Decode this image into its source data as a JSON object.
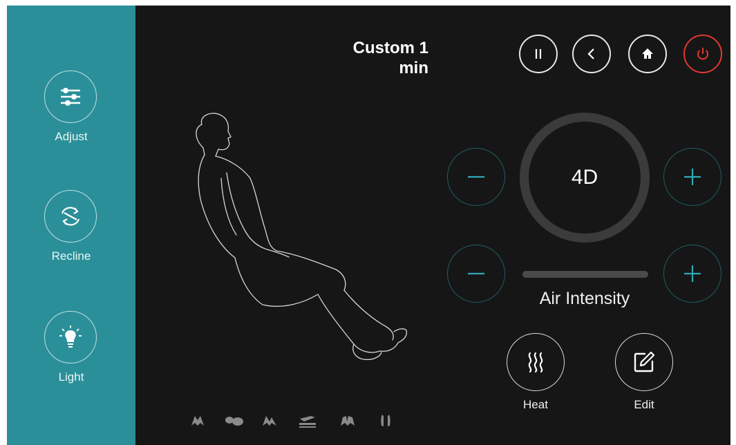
{
  "sidebar": {
    "items": [
      {
        "label": "Adjust",
        "icon": "sliders-icon"
      },
      {
        "label": "Recline",
        "icon": "recline-icon"
      },
      {
        "label": "Light",
        "icon": "lightbulb-icon"
      }
    ]
  },
  "header": {
    "title_line1": "Custom 1",
    "title_line2": "min"
  },
  "top_controls": [
    "pause-icon",
    "back-icon",
    "home-icon",
    "power-icon"
  ],
  "dial": {
    "label": "4D"
  },
  "air": {
    "label": "Air Intensity"
  },
  "functions": [
    {
      "label": "Heat",
      "icon": "heat-icon"
    },
    {
      "label": "Edit",
      "icon": "edit-icon"
    }
  ],
  "mode_icons": [
    "shoulder-icon",
    "back-massage-icon",
    "waist-icon",
    "seat-icon",
    "calf-icon",
    "foot-icon"
  ],
  "colors": {
    "sidebar": "#2b8f99",
    "background": "#161616",
    "accent": "#2eaab8",
    "power": "#e0392f"
  }
}
